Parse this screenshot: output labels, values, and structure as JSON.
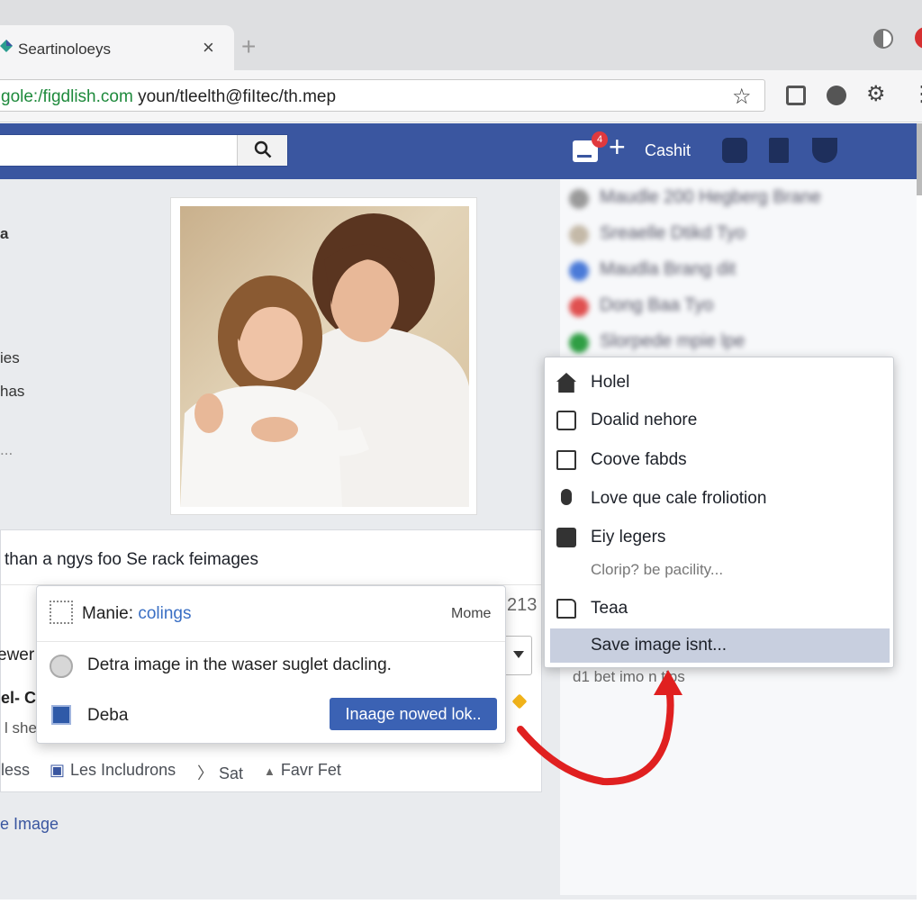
{
  "browser": {
    "tab_title": "Seartinoloeys",
    "tab_close": "×",
    "new_tab": "+",
    "url_host": "gole:/figdlish.com",
    "url_path": " youn/tleelth@fiItec/th.mep",
    "star": "☆",
    "gear": "⚙"
  },
  "fb_header": {
    "notification_count": "4",
    "plus": "+",
    "cashit_label": "Cashit"
  },
  "left_fragments": [
    "a",
    "ies",
    "has",
    "..."
  ],
  "blurred_list": [
    {
      "text": "Maudle 200 Hegberg Brane",
      "color": "#9a9a9a"
    },
    {
      "text": "Sreaelle Dtikd Tyo",
      "color": "#c4b9a8"
    },
    {
      "text": "Maudla Brang dit",
      "color": "#4a7ad8"
    },
    {
      "text": "Dong Baa Tyo",
      "color": "#e05050"
    },
    {
      "text": "Slorpede mpie lpe",
      "color": "#2f9e44"
    }
  ],
  "post": {
    "caption": "than a ngys foo Se rack feimages",
    "frag_ewer": "ewer",
    "frag_elc": "el- C",
    "frag_she": "l she",
    "frag_213": "213",
    "actions": [
      {
        "label": "less",
        "icon": ""
      },
      {
        "label": "Les Includrons",
        "icon": "▣"
      },
      {
        "label": "Sat",
        "icon": "〉"
      },
      {
        "label": "Favr Fet",
        "icon": "▲"
      }
    ],
    "image_link": "e Image"
  },
  "popup": {
    "label_prefix": "Manie: ",
    "label_value": "colings",
    "more": "Mome",
    "description": "Detra image in the waser suglet dacling.",
    "deba": "Deba",
    "button": "Inaage nowed lok.."
  },
  "context_menu": {
    "items": [
      {
        "label": "Holel",
        "icon": "home-icon"
      },
      {
        "label": "Doalid nehore",
        "icon": "message-icon"
      },
      {
        "label": "Coove fabds",
        "icon": "checkbox-icon"
      },
      {
        "label": "Love que cale froliotion",
        "icon": "microphone-icon"
      },
      {
        "label": "Eiy legers",
        "icon": "card-icon"
      },
      {
        "label": "Teaa",
        "icon": "folder-icon"
      },
      {
        "label": "Save  image isnt...",
        "icon": ""
      }
    ],
    "subtext": "Clorip? be pacility..."
  },
  "under_text": "d1 bet imo  n tips",
  "colors": {
    "fb_blue": "#3a56a0",
    "highlight": "#c8cfdf",
    "arrow_red": "#e02020",
    "url_green": "#1e8a3c"
  }
}
